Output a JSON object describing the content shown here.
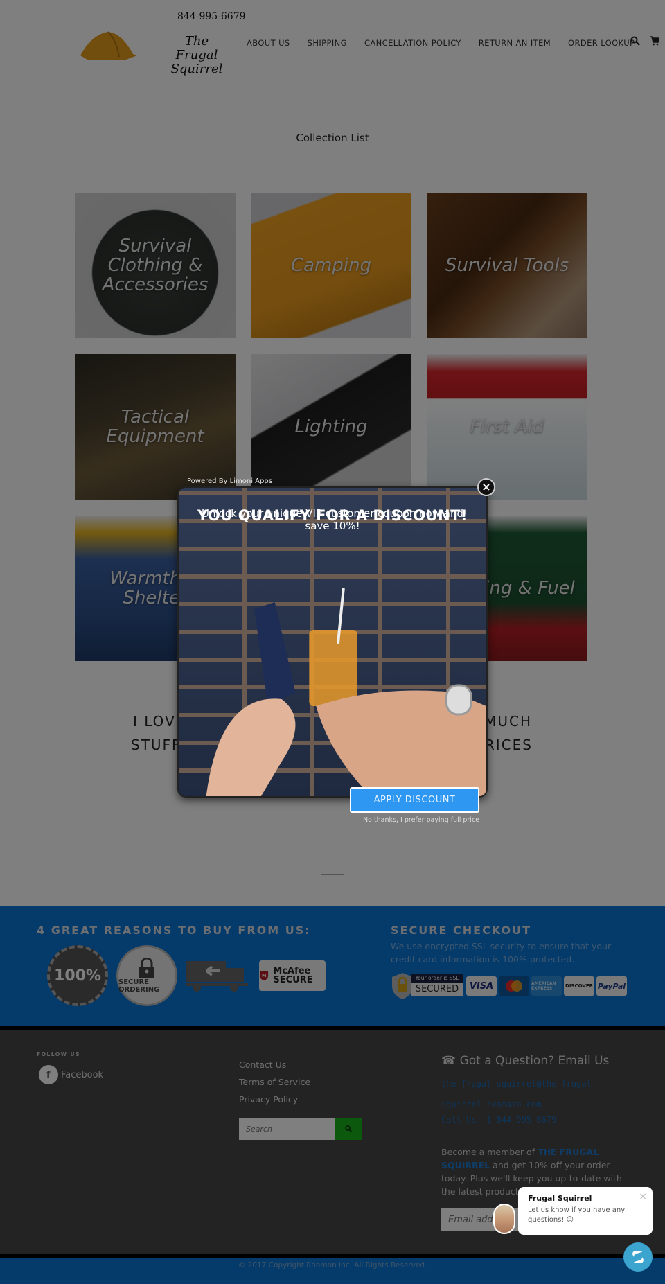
{
  "header": {
    "phone": "844-995-6679",
    "logo_line1": "The",
    "logo_line2": "Frugal Squirrel",
    "nav": [
      "ABOUT US",
      "SHIPPING",
      "CANCELLATION POLICY",
      "RETURN AN ITEM",
      "ORDER LOOKUP"
    ],
    "icons": {
      "search": "search-icon",
      "cart": "cart-icon"
    }
  },
  "collection": {
    "title": "Collection List",
    "tiles": [
      {
        "label": "Survival Clothing & Accessories"
      },
      {
        "label": "Camping"
      },
      {
        "label": "Survival Tools"
      },
      {
        "label": "Tactical Equipment"
      },
      {
        "label": "Lighting"
      },
      {
        "label": "First Aid"
      },
      {
        "label": "Warmth & Shelter"
      },
      {
        "label": ""
      },
      {
        "label": "Cooking & Fuel"
      }
    ]
  },
  "tagline": {
    "line1_left": "I LOVE",
    "line1_right": "MUCH",
    "line2_left": "STUFF",
    "line2_right": "RICES"
  },
  "reasons": {
    "title": "4 GREAT REASONS TO BUY FROM US:",
    "badges": [
      "100%",
      "SECURE ORDERING",
      "EASY RETURNS",
      "McAfee SECURE"
    ],
    "secure_title": "SECURE CHECKOUT",
    "secure_text": "We use encrypted SSL security to ensure that your credit card information is 100% protected.",
    "ssl_badge_top": "Your order is SSL",
    "ssl_badge_bottom": "SECURED",
    "cards": [
      "VISA",
      "MasterCard",
      "AMERICAN EXPRESS",
      "DISCOVER",
      "PayPal"
    ]
  },
  "footer": {
    "follow_label": "FOLLOW US",
    "facebook": "Facebook",
    "links": [
      "Contact Us",
      "Terms of Service",
      "Privacy Policy"
    ],
    "search_placeholder": "Search",
    "question_title": "Got a Question? Email Us",
    "email": "the-frugal-squirrel@the-frugal-squirrel.reamaze.com",
    "call": "Call Us: 1-844-995-6679",
    "member_prefix": "Become a member of ",
    "member_brand": "THE FRUGAL SQUIRREL",
    "member_suffix": " and get 10% off your order today. Plus we'll keep you up-to-date with the latest products and offers.",
    "email_placeholder": "Email address",
    "copyright": "© 2017 Copyright Ranmon Inc. All Rights Reserved."
  },
  "popup": {
    "powered_prefix": "Powered By ",
    "powered_link": "Limoni Apps",
    "headline": "YOU QUALIFY FOR A DISCOUNT!",
    "subtext": "Unlock your unique VIP customer coupon now and save 10%!",
    "close": "×",
    "apply": "APPLY DISCOUNT",
    "no_thanks": "No thanks, I prefer paying full price"
  },
  "chat": {
    "name": "Frugal Squirrel",
    "message": "Let us know if you have any questions! ☺",
    "close": "×"
  }
}
